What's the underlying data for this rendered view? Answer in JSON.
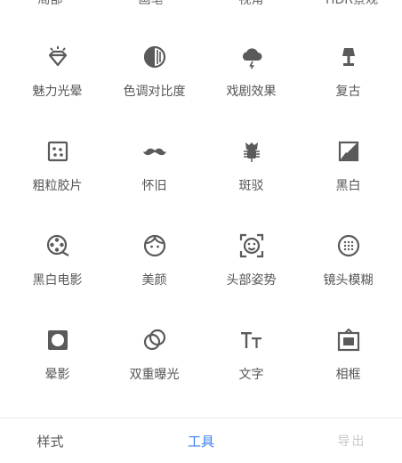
{
  "partial_row": [
    "局部",
    "画笔",
    "视角",
    "HDR景观"
  ],
  "tools": [
    {
      "label": "魅力光晕",
      "icon": "diamond-glow-icon"
    },
    {
      "label": "色调对比度",
      "icon": "tonal-contrast-icon"
    },
    {
      "label": "戏剧效果",
      "icon": "storm-cloud-icon"
    },
    {
      "label": "复古",
      "icon": "lamp-icon"
    },
    {
      "label": "粗粒胶片",
      "icon": "grainy-film-icon"
    },
    {
      "label": "怀旧",
      "icon": "mustache-icon"
    },
    {
      "label": "斑驳",
      "icon": "grunge-guitar-icon"
    },
    {
      "label": "黑白",
      "icon": "black-white-icon"
    },
    {
      "label": "黑白电影",
      "icon": "film-reel-icon"
    },
    {
      "label": "美颜",
      "icon": "face-icon"
    },
    {
      "label": "头部姿势",
      "icon": "face-pose-icon"
    },
    {
      "label": "镜头模糊",
      "icon": "lens-blur-icon"
    },
    {
      "label": "晕影",
      "icon": "vignette-icon"
    },
    {
      "label": "双重曝光",
      "icon": "double-exposure-icon"
    },
    {
      "label": "文字",
      "icon": "text-icon"
    },
    {
      "label": "相框",
      "icon": "frame-icon"
    }
  ],
  "tabs": {
    "styles": "样式",
    "tools": "工具",
    "export": "导出"
  },
  "colors": {
    "icon": "#5a5a5a",
    "active_tab": "#3d7ff0",
    "divider": "#ececec"
  }
}
